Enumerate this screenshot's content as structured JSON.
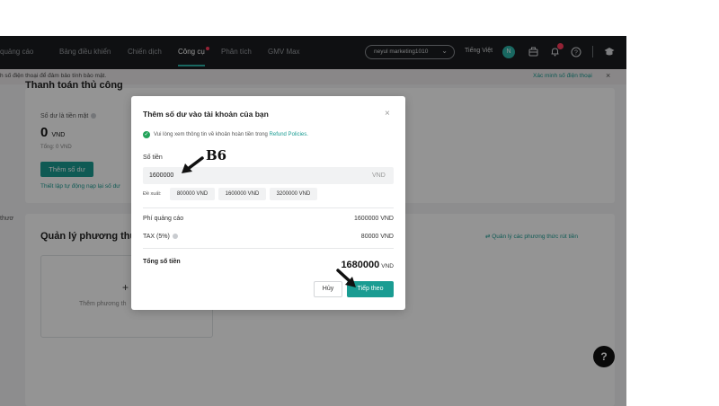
{
  "nav": {
    "items": [
      "quảng cáo",
      "Bảng điều khiển",
      "Chiến dịch",
      "Công cụ",
      "Phân tích",
      "GMV Max"
    ],
    "account": "neyul marketing1010",
    "language": "Tiếng Việt",
    "avatar_initial": "N",
    "icons": [
      "briefcase-icon",
      "bell-icon",
      "help-icon",
      "graduation-cap-icon"
    ],
    "accent_color": "#2bb3a8"
  },
  "notice": {
    "text": "h số điện thoại để đảm bảo tính bảo mật.",
    "link": "Xác minh số điện thoại"
  },
  "background": {
    "section_title": "Thanh toán thủ công",
    "balance_label": "Số dư là tiền mặt",
    "balance_value": "0",
    "balance_unit": "VND",
    "total_line": "Tổng: 0 VND",
    "add_button": "Thêm số dư",
    "auto_link": "Thiết lập tự động nạp lại số dư",
    "left_cut_text": "thươ",
    "methods_title": "Quản lý phương thức",
    "methods_link": "⇄ Quản lý các phương thức rút tiền",
    "add_method_plus": "+",
    "add_method_text": "Thêm phương th"
  },
  "modal": {
    "title": "Thêm số dư vào tài khoản của bạn",
    "refund_text": "Vui lòng xem thông tin về khoản hoàn tiền trong",
    "refund_link": "Refund Policies.",
    "amount_label": "Số tiền",
    "amount_value": "1600000",
    "amount_unit": "VND",
    "suggest_label": "Đề xuất:",
    "suggestions": [
      "800000 VND",
      "1600000 VND",
      "3200000 VND"
    ],
    "ad_fee_label": "Phí quảng cáo",
    "ad_fee_value": "1600000 VND",
    "tax_label": "TAX (5%)",
    "tax_value": "80000 VND",
    "total_label": "Tổng số tiền",
    "total_value": "1680000",
    "total_unit": "VND",
    "cancel_button": "Hủy",
    "next_button": "Tiếp theo",
    "primary_color": "#1a9c92"
  },
  "annotation": {
    "step_label": "B6"
  }
}
